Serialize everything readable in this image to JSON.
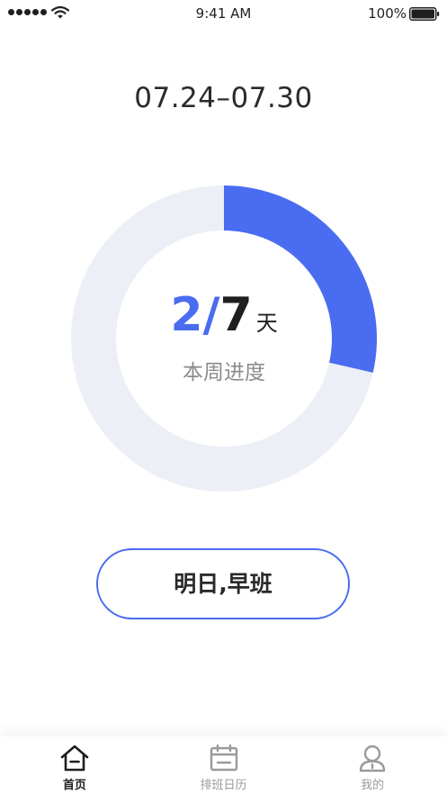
{
  "status_bar": {
    "time": "9:41 AM",
    "battery_percent": "100%",
    "signal_bars": 5,
    "battery_level": 1.0
  },
  "week": {
    "date_range": "07.24–07.30"
  },
  "progress": {
    "done": "2",
    "separator": "/",
    "total": "7",
    "unit": "天",
    "label": "本周进度",
    "fraction": 0.2857,
    "colors": {
      "filled": "#4a6cf0",
      "track": "#eceff6"
    }
  },
  "shift_button": {
    "label": "明日,早班"
  },
  "tab_bar": {
    "active_index": 0,
    "tabs": [
      {
        "label": "首页",
        "icon": "home-icon"
      },
      {
        "label": "排班日历",
        "icon": "calendar-icon"
      },
      {
        "label": "我的",
        "icon": "profile-icon"
      }
    ]
  }
}
